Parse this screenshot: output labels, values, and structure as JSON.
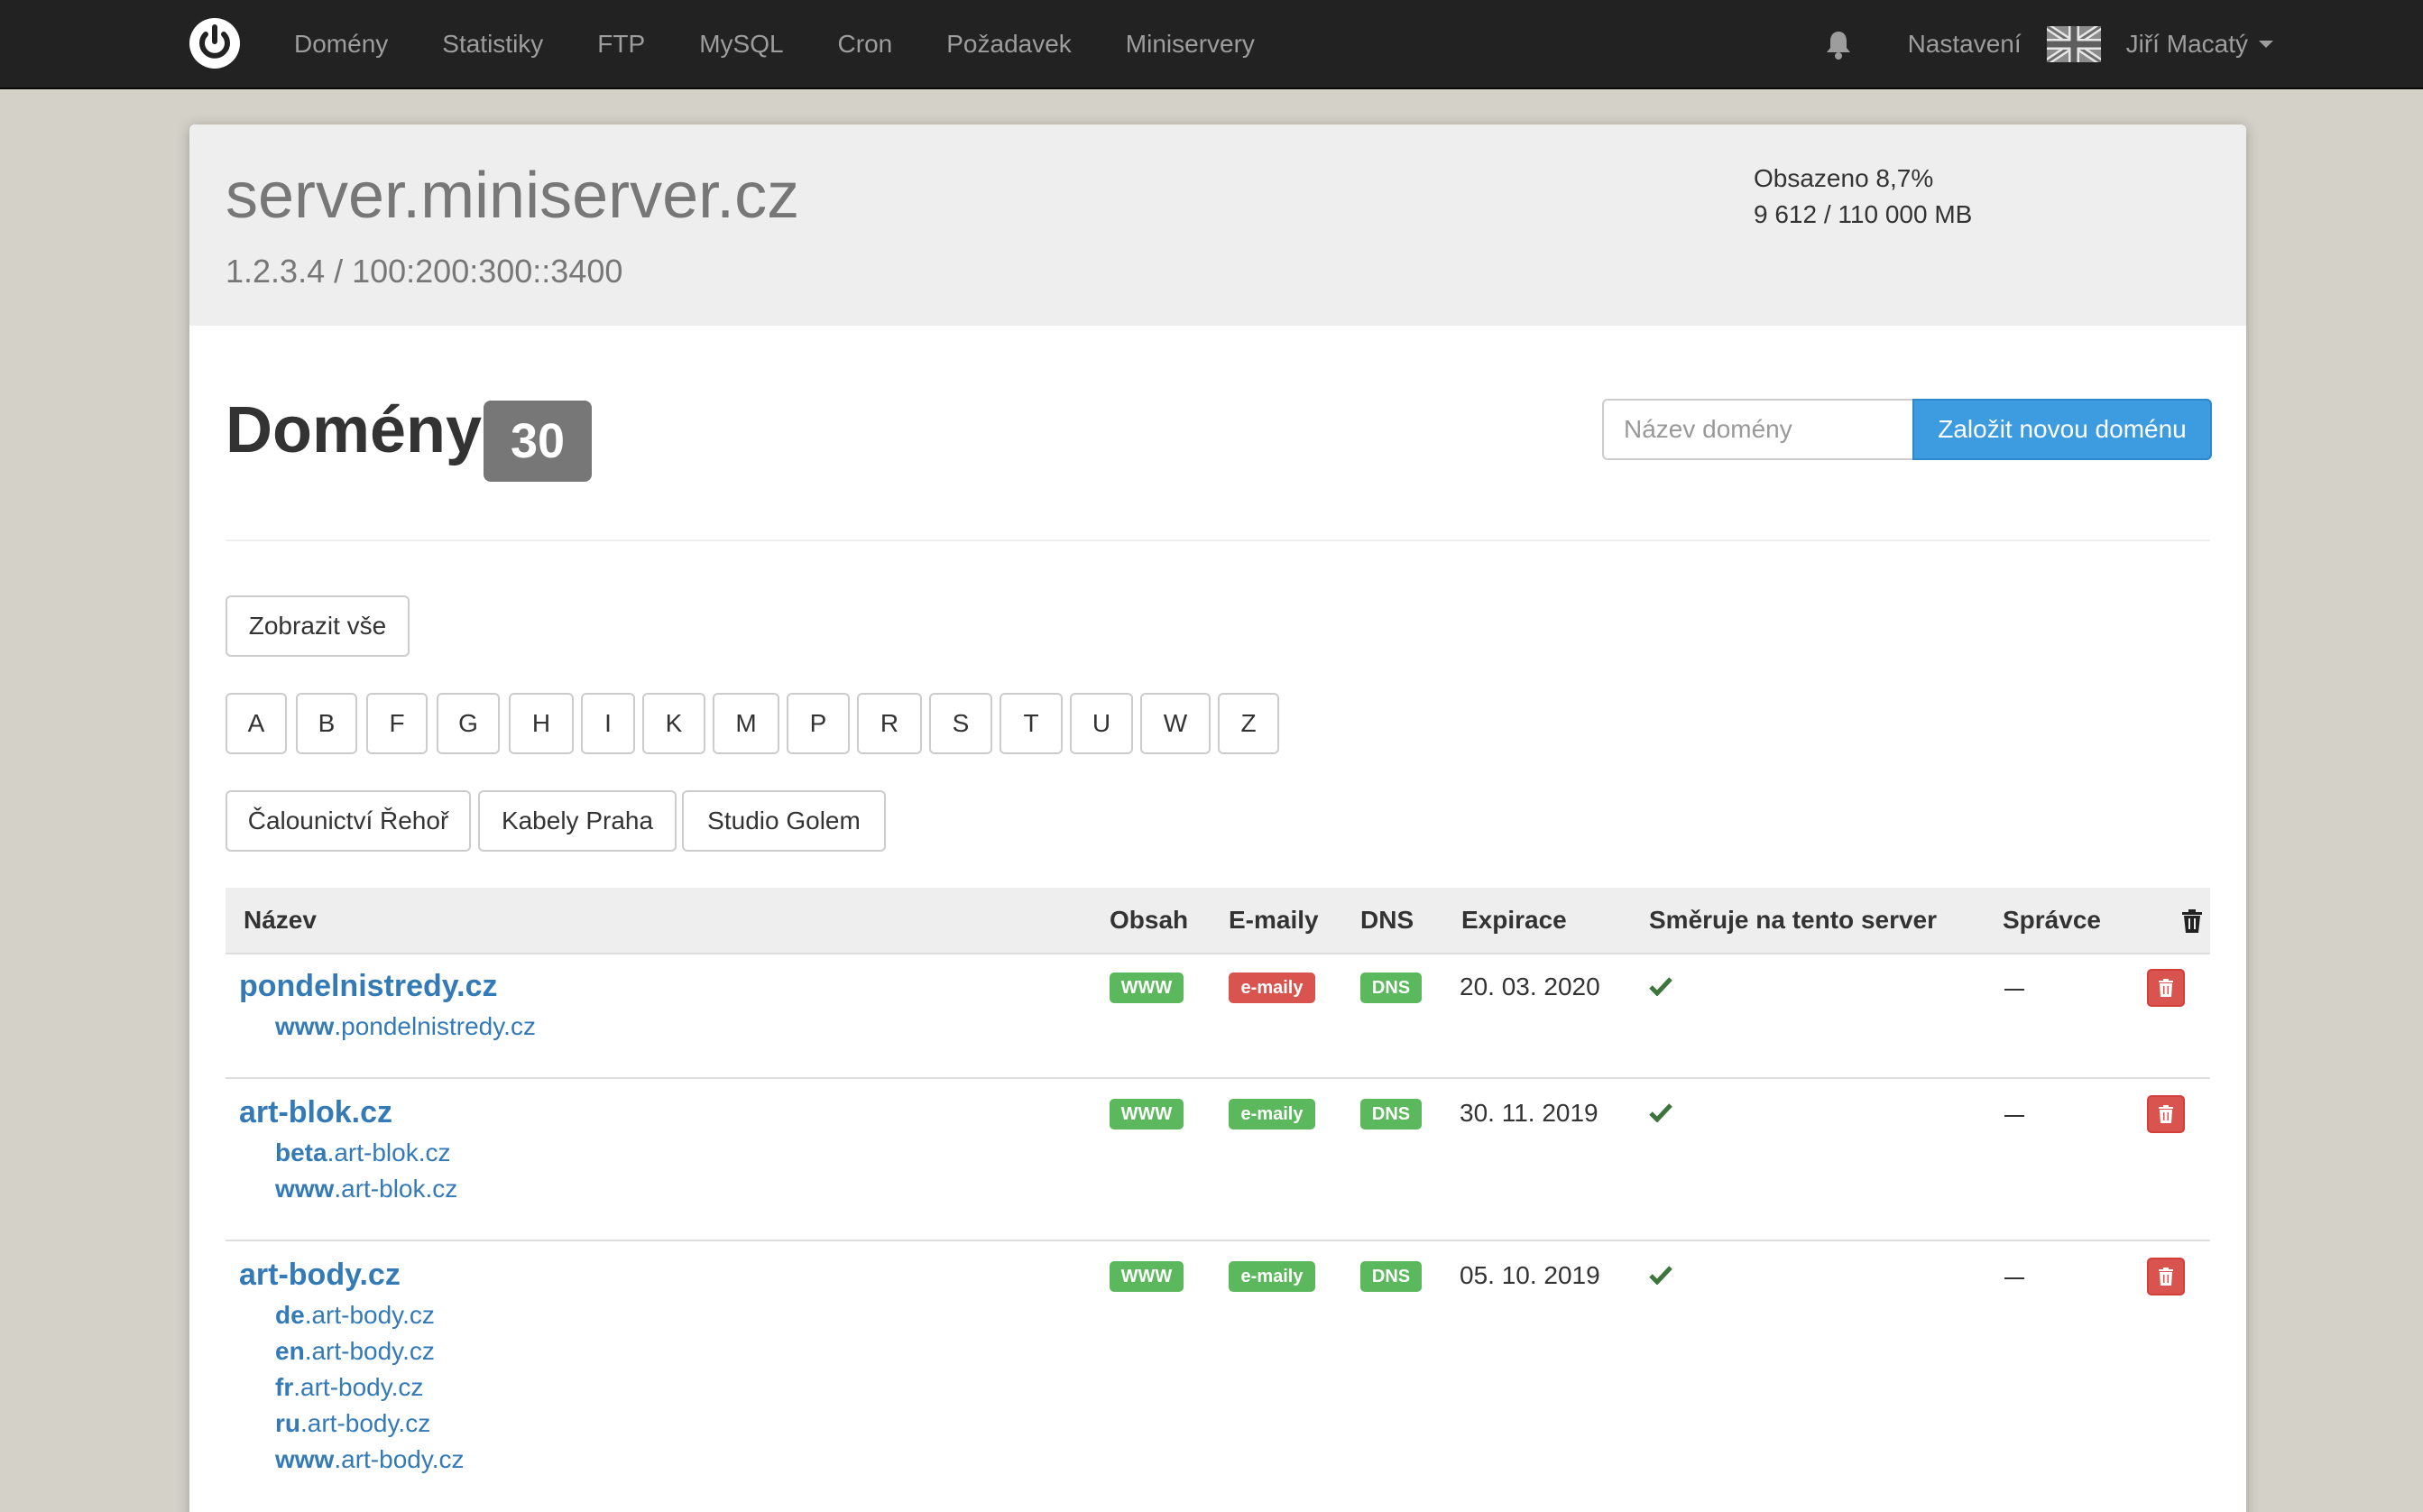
{
  "nav": {
    "items": [
      "Domény",
      "Statistiky",
      "FTP",
      "MySQL",
      "Cron",
      "Požadavek",
      "Miniservery"
    ],
    "settings": "Nastavení",
    "user": "Jiří Macatý"
  },
  "server": {
    "name": "server.miniserver.cz",
    "ip": "1.2.3.4 / 100:200:300::3400",
    "usage_percent": "Obsazeno 8,7%",
    "usage_mb": "9 612 / 110 000 MB"
  },
  "domains": {
    "title": "Domény",
    "count": "30",
    "input_placeholder": "Název domény",
    "create_button": "Založit novou doménu",
    "show_all": "Zobrazit vše",
    "letters": [
      "A",
      "B",
      "F",
      "G",
      "H",
      "I",
      "K",
      "M",
      "P",
      "R",
      "S",
      "T",
      "U",
      "W",
      "Z"
    ],
    "clients": [
      "Čalounictví Řehoř",
      "Kabely Praha",
      "Studio Golem"
    ]
  },
  "table": {
    "headers": [
      "Název",
      "Obsah",
      "E-maily",
      "DNS",
      "Expirace",
      "Směruje na tento server",
      "Správce"
    ],
    "rows": [
      {
        "name": "pondelnistredy.cz",
        "subdomains": [
          [
            "www",
            ".pondelnistredy.cz"
          ]
        ],
        "www": "WWW",
        "emails": "e-maily",
        "emails_status": "red",
        "dns": "DNS",
        "expiry": "20. 03. 2020"
      },
      {
        "name": "art-blok.cz",
        "subdomains": [
          [
            "beta",
            ".art-blok.cz"
          ],
          [
            "www",
            ".art-blok.cz"
          ]
        ],
        "www": "WWW",
        "emails": "e-maily",
        "emails_status": "green",
        "dns": "DNS",
        "expiry": "30. 11. 2019"
      },
      {
        "name": "art-body.cz",
        "subdomains": [
          [
            "de",
            ".art-body.cz"
          ],
          [
            "en",
            ".art-body.cz"
          ],
          [
            "fr",
            ".art-body.cz"
          ],
          [
            "ru",
            ".art-body.cz"
          ],
          [
            "www",
            ".art-body.cz"
          ]
        ],
        "www": "WWW",
        "emails": "e-maily",
        "emails_status": "green",
        "dns": "DNS",
        "expiry": "05. 10. 2019"
      }
    ]
  },
  "colors": {
    "navbar": "#222222",
    "primary": "#3d9be0",
    "link": "#337ab7",
    "success": "#5cb85c",
    "danger": "#d9534f",
    "check": "#3c763d"
  },
  "icons": {
    "logo": "power-logo-icon",
    "bell": "bell-icon",
    "flag": "uk-flag-icon",
    "trash": "trash-icon",
    "check": "check-icon"
  }
}
